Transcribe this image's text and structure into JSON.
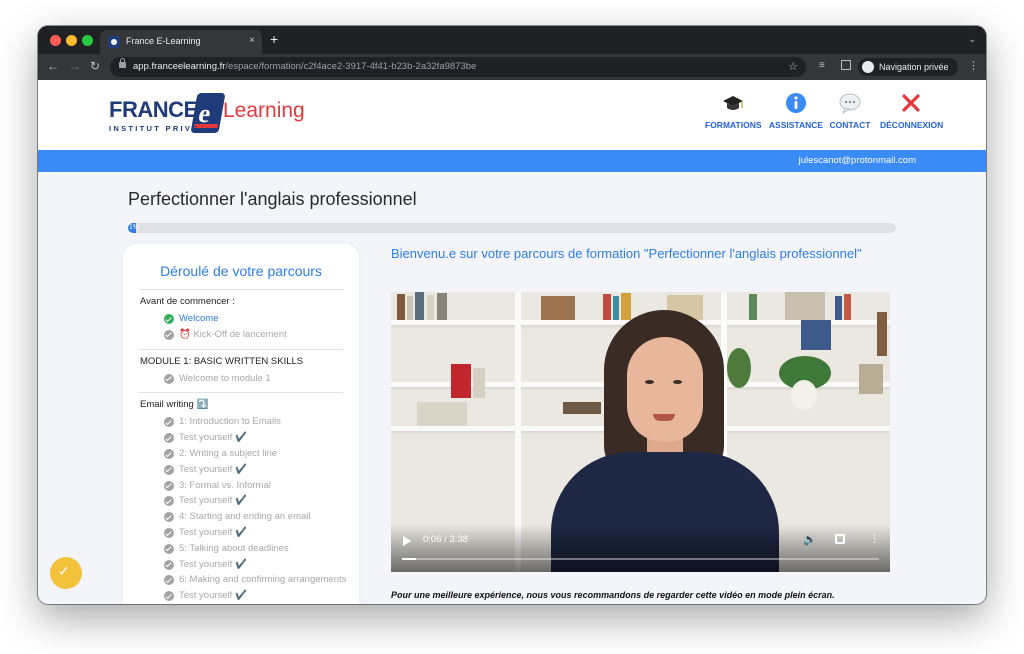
{
  "browser": {
    "tab_title": "France E-Learning",
    "tab_close": "×",
    "new_tab": "+",
    "tab_menu": "⌄",
    "url_host": "app.franceelearning.fr",
    "url_path": "/espace/formation/c2f4ace2-3917-4f41-b23b-2a32fa9873be",
    "profile_label": "Navigation privée",
    "back": "←",
    "forward": "→",
    "reload": "↻",
    "star": "☆",
    "menu": "⋮"
  },
  "site": {
    "logo_france": "FRANCE",
    "logo_e": "e",
    "logo_learning": "Learning",
    "logo_sub": "INSTITUT PRIVÉ",
    "nav": {
      "formations": "FORMATIONS",
      "assistance": "ASSISTANCE",
      "contact": "CONTACT",
      "deconnexion": "DÉCONNEXION"
    },
    "user_email": "julescanot@protonmail.com"
  },
  "course": {
    "title": "Perfectionner l'anglais professionnel",
    "progress_percent": 1,
    "progress_label": "1%"
  },
  "sidebar": {
    "title": "Déroulé de votre parcours",
    "sections": [
      {
        "label": "Avant de commencer :",
        "lessons": [
          {
            "label": "Welcome",
            "done": true
          },
          {
            "label": "⏰ Kick-Off de lancement",
            "done": false
          }
        ]
      },
      {
        "label": "MODULE 1: BASIC WRITTEN SKILLS",
        "lessons": [
          {
            "label": "Welcome to module 1",
            "done": false
          }
        ]
      },
      {
        "label": "Email writing ⤵️",
        "lessons": [
          {
            "label": "1: Introduction to Emails",
            "done": false
          },
          {
            "label": "Test yourself ✔️",
            "done": false
          },
          {
            "label": "2: Writing a subject line",
            "done": false
          },
          {
            "label": "Test yourself ✔️",
            "done": false
          },
          {
            "label": "3: Formal vs. Informal",
            "done": false
          },
          {
            "label": "Test yourself ✔️",
            "done": false
          },
          {
            "label": "4: Starting and ending an email",
            "done": false
          },
          {
            "label": "Test yourself ✔️",
            "done": false
          },
          {
            "label": "5: Talking about deadlines",
            "done": false
          },
          {
            "label": "Test yourself ✔️",
            "done": false
          },
          {
            "label": "6: Making and confirming arrangements",
            "done": false
          },
          {
            "label": "Test yourself ✔️",
            "done": false
          }
        ]
      }
    ]
  },
  "main": {
    "welcome": "Bienvenu.e sur votre parcours de formation \"Perfectionner l'anglais professionnel\"",
    "video": {
      "time": "0:06 / 3:38",
      "played_fraction": 0.03
    },
    "note": "Pour une meilleure expérience, nous vous recommandons de regarder cette vidéo en mode plein écran."
  },
  "colors": {
    "accent": "#2e7de6",
    "band": "#3b8bf6",
    "brand_navy": "#1f3b7a",
    "brand_red": "#e5383b",
    "done_green": "#33b05d",
    "help_yellow": "#f2c23b"
  }
}
